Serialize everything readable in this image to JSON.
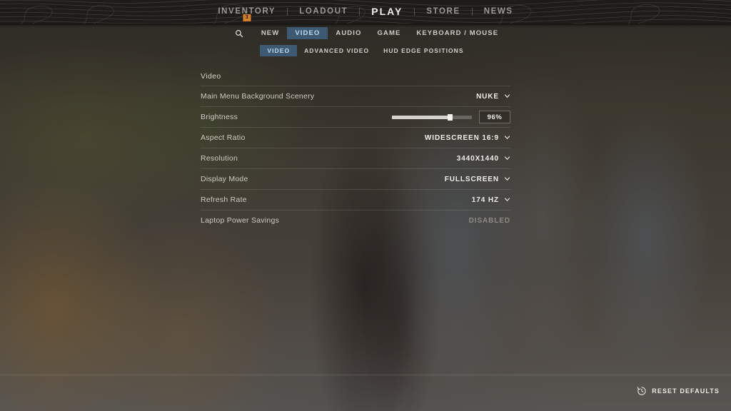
{
  "header": {
    "nav": [
      {
        "label": "INVENTORY",
        "active": false,
        "badge": "3"
      },
      {
        "label": "LOADOUT",
        "active": false,
        "badge": null
      },
      {
        "label": "PLAY",
        "active": true,
        "badge": null
      },
      {
        "label": "STORE",
        "active": false,
        "badge": null
      },
      {
        "label": "NEWS",
        "active": false,
        "badge": null
      }
    ]
  },
  "subnav": {
    "search_icon": "search-icon",
    "items": [
      {
        "label": "NEW",
        "active": false
      },
      {
        "label": "VIDEO",
        "active": true
      },
      {
        "label": "AUDIO",
        "active": false
      },
      {
        "label": "GAME",
        "active": false
      },
      {
        "label": "KEYBOARD / MOUSE",
        "active": false
      }
    ]
  },
  "tabs": [
    {
      "label": "VIDEO",
      "active": true
    },
    {
      "label": "ADVANCED VIDEO",
      "active": false
    },
    {
      "label": "HUD EDGE POSITIONS",
      "active": false
    }
  ],
  "settings": {
    "section_title": "Video",
    "rows": [
      {
        "label": "Main Menu Background Scenery",
        "value": "NUKE",
        "type": "dropdown",
        "enabled": true
      },
      {
        "label": "Brightness",
        "value": "96%",
        "type": "slider",
        "percent": 72,
        "enabled": true
      },
      {
        "label": "Aspect Ratio",
        "value": "WIDESCREEN 16:9",
        "type": "dropdown",
        "enabled": true
      },
      {
        "label": "Resolution",
        "value": "3440X1440",
        "type": "dropdown",
        "enabled": true
      },
      {
        "label": "Display Mode",
        "value": "FULLSCREEN",
        "type": "dropdown",
        "enabled": true
      },
      {
        "label": "Refresh Rate",
        "value": "174 HZ",
        "type": "dropdown",
        "enabled": true
      },
      {
        "label": "Laptop Power Savings",
        "value": "DISABLED",
        "type": "static",
        "enabled": false
      }
    ]
  },
  "footer": {
    "reset_label": "RESET DEFAULTS",
    "reset_icon": "history-clock-icon"
  },
  "colors": {
    "accent_highlight_bg": "#3e5a72",
    "accent_highlight_text": "#bcdcf2",
    "badge_orange": "#d2802a",
    "header_bg": "#1e1c1a",
    "text_primary": "#f0eeea",
    "text_secondary": "#cfccc6",
    "text_disabled": "#8e8a84"
  }
}
